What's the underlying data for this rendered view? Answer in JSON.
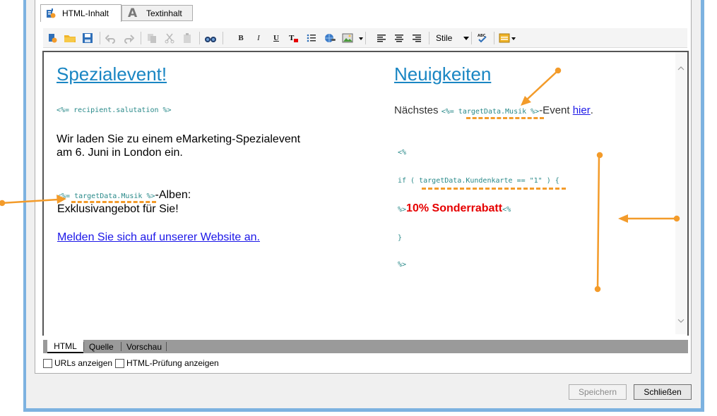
{
  "tabs": [
    {
      "label": "HTML-Inhalt",
      "icon": "html-content-icon",
      "active": true
    },
    {
      "label": "Textinhalt",
      "icon": "text-content-icon",
      "active": false
    }
  ],
  "toolbar": {
    "bold": "B",
    "italic": "I",
    "underline": "U",
    "style_label": "Stile"
  },
  "editor": {
    "left": {
      "title": "Spezialevent!",
      "salutation_code": "<%= recipient.salutation %>",
      "invite_line1": "Wir laden Sie zu einem eMarketing-Spezialevent",
      "invite_line2": "am 6. Juni in London ein.",
      "musik_open": "<%= ",
      "musik_code": "targetData.Musik",
      "musik_close": " %>",
      "alben_text": "-Alben:",
      "offer_text": "Exklusivangebot für Sie!",
      "website_link": "Melden Sie sich auf unserer Website an."
    },
    "right": {
      "title": "Neuigkeiten",
      "next_prefix": "Nächstes ",
      "next_code_open": "<%= ",
      "next_code": "targetData.Musik",
      "next_code_close": " %>",
      "next_suffix": "-Event ",
      "next_link": "hier",
      "next_period": ".",
      "code_open": "<%",
      "if_prefix": "if ( ",
      "if_code": "targetData.Kundenkarte == \"1\"",
      "if_suffix": " ) {",
      "discount_open": "%>",
      "discount_text": "10% Sonderrabatt",
      "discount_close": "<%",
      "brace_close": "}",
      "code_close": "%>"
    }
  },
  "bottom_tabs": [
    "HTML",
    "Quelle",
    "Vorschau"
  ],
  "options": {
    "show_urls": "URLs anzeigen",
    "html_check": "HTML-Prüfung anzeigen"
  },
  "buttons": {
    "save": "Speichern",
    "close": "Schließen"
  },
  "colors": {
    "accent_orange": "#f39b2a",
    "title_blue": "#1a86c3",
    "link_blue": "#1c17e8",
    "discount_red": "#e60000",
    "window_border": "#7db2e0"
  }
}
